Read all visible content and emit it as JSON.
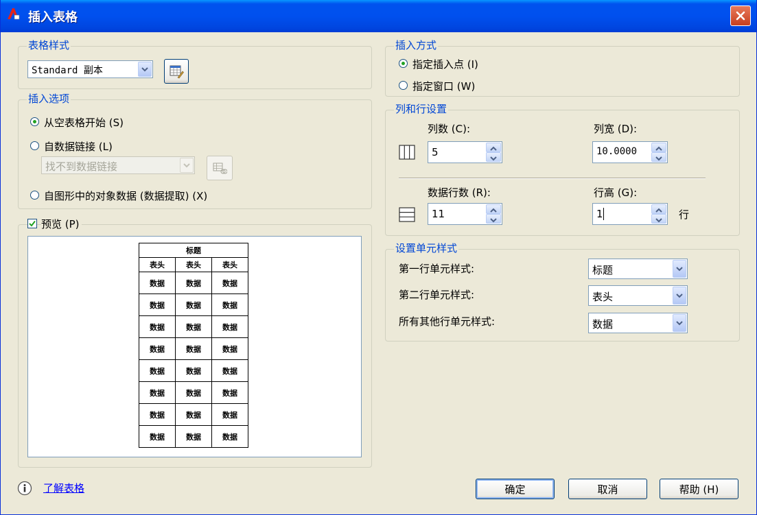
{
  "window": {
    "title": "插入表格"
  },
  "table_style": {
    "group_label": "表格样式",
    "selected": "Standard 副本"
  },
  "insert_options": {
    "group_label": "插入选项",
    "from_empty": "从空表格开始 (S)",
    "from_datalink": "自数据链接 (L)",
    "datalink_value": "找不到数据链接",
    "from_objects": "自图形中的对象数据 (数据提取) (X)"
  },
  "preview": {
    "label": "预览 (P)",
    "title_cell": "标题",
    "header_cells": [
      "表头",
      "表头",
      "表头"
    ],
    "data_rows": [
      [
        "数据",
        "数据",
        "数据"
      ],
      [
        "数据",
        "数据",
        "数据"
      ],
      [
        "数据",
        "数据",
        "数据"
      ],
      [
        "数据",
        "数据",
        "数据"
      ],
      [
        "数据",
        "数据",
        "数据"
      ],
      [
        "数据",
        "数据",
        "数据"
      ],
      [
        "数据",
        "数据",
        "数据"
      ],
      [
        "数据",
        "数据",
        "数据"
      ]
    ]
  },
  "insert_method": {
    "group_label": "插入方式",
    "point": "指定插入点 (I)",
    "window": "指定窗口 (W)"
  },
  "rows_cols": {
    "group_label": "列和行设置",
    "columns_label": "列数 (C):",
    "columns_value": "5",
    "col_width_label": "列宽 (D):",
    "col_width_value": "10.0000",
    "data_rows_label": "数据行数 (R):",
    "data_rows_value": "11",
    "row_height_label": "行高 (G):",
    "row_height_value": "1",
    "row_height_unit": "行"
  },
  "cell_styles": {
    "group_label": "设置单元样式",
    "first_row_label": "第一行单元样式:",
    "first_row_value": "标题",
    "second_row_label": "第二行单元样式:",
    "second_row_value": "表头",
    "other_rows_label": "所有其他行单元样式:",
    "other_rows_value": "数据"
  },
  "footer": {
    "learn_link": "了解表格",
    "ok": "确定",
    "cancel": "取消",
    "help": "帮助 (H)"
  }
}
